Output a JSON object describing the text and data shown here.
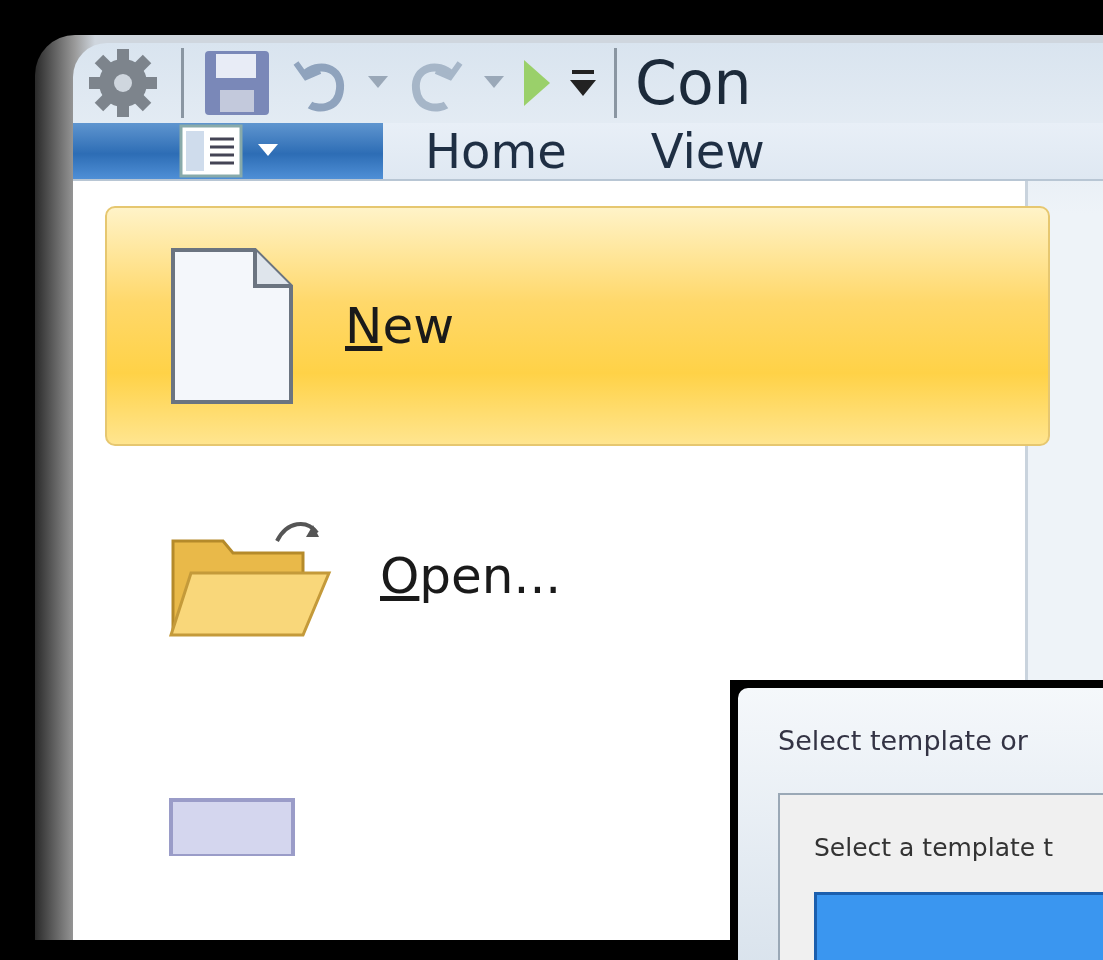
{
  "window": {
    "title": "Con"
  },
  "app_menu_button": {
    "open": true
  },
  "tabs": [
    {
      "label": "Home",
      "selected": false
    },
    {
      "label": "View",
      "selected": false
    }
  ],
  "menu_items": [
    {
      "kind": "new",
      "label": "New",
      "selected": true
    },
    {
      "kind": "open",
      "label": "Open...",
      "selected": false
    },
    {
      "kind": "save",
      "selected": false
    }
  ],
  "dialog": {
    "title": "Select template or",
    "prompt": "Select a template t"
  }
}
